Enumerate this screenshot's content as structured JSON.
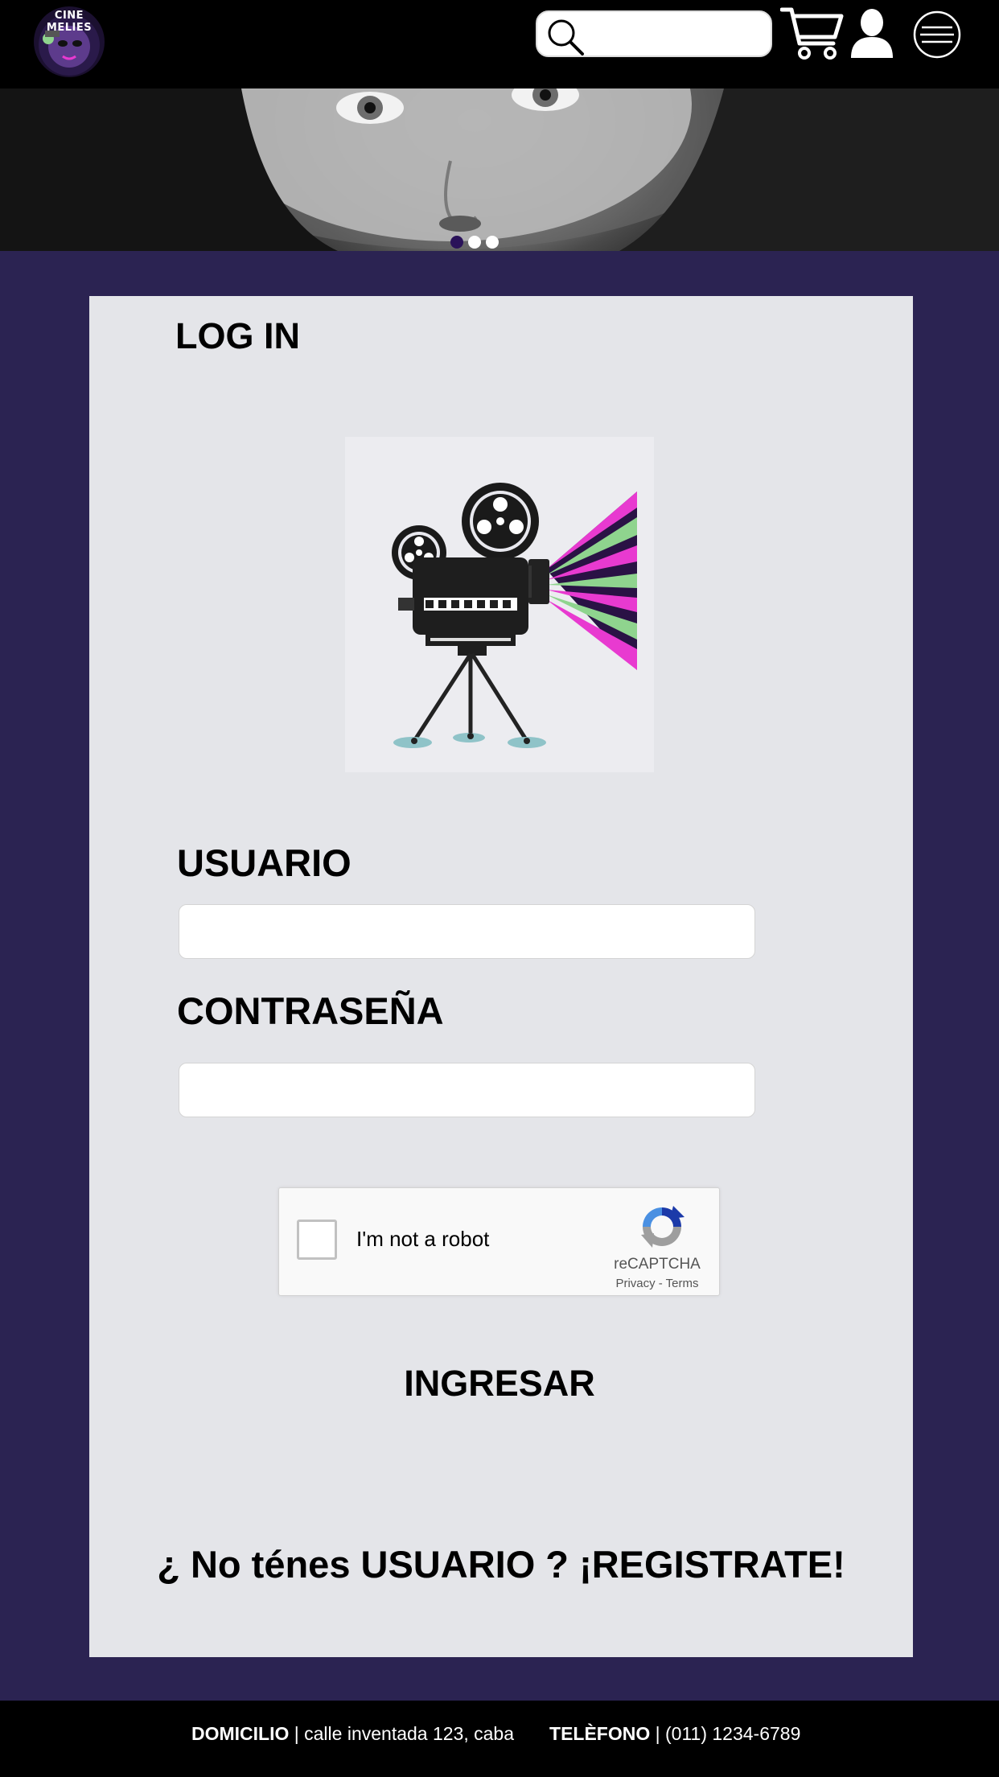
{
  "header": {
    "logo_text": "CINE MELIES",
    "search_placeholder": "",
    "icons": [
      "search-icon",
      "cart-icon",
      "user-icon",
      "menu-icon"
    ]
  },
  "hero": {
    "slides_count": 3,
    "active_slide": 1
  },
  "login": {
    "title": "LOG IN",
    "usuario_label": "USUARIO",
    "usuario_value": "",
    "password_label": "CONTRASEÑA",
    "password_value": "",
    "captcha_label": "I'm not a robot",
    "captcha_brand": "reCAPTCHA",
    "captcha_links": "Privacy - Terms",
    "submit_label": "INGRESAR",
    "register_text": "¿ No ténes USUARIO ? ¡REGISTRATE!"
  },
  "footer": {
    "address_label": "DOMICILIO",
    "address_value": " | calle inventada 123, caba",
    "phone_label": "TELÈFONO",
    "phone_value": " | (011) 1234-6789"
  },
  "colors": {
    "header_bg": "#000000",
    "page_bg": "#2b2352",
    "card_bg": "#e4e5e9",
    "dot_active": "#2a1259",
    "dot_inactive": "#ffffff",
    "ray_pink": "#e83ad0",
    "ray_green": "#8fd48e",
    "ray_dark": "#2a1245"
  }
}
